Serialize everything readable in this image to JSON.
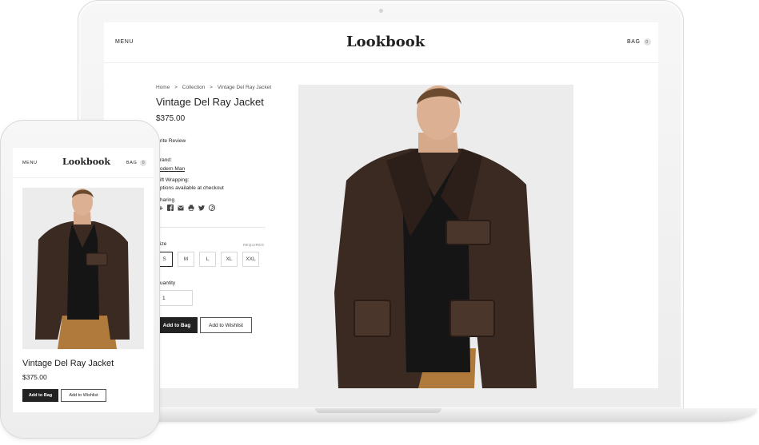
{
  "desktop": {
    "header": {
      "menu_label": "MENU",
      "logo": "Lookbook",
      "bag_label": "BAG",
      "bag_count": "0"
    },
    "breadcrumb": [
      "Home",
      ">",
      "Collection",
      ">",
      "Vintage Del Ray Jacket"
    ],
    "product": {
      "title": "Vintage Del Ray Jacket",
      "price": "$375.00",
      "write_review": "rite Review",
      "brand_label": "rand:",
      "brand_value": "odern Man",
      "gift_label": "ift Wrapping:",
      "gift_value": "ptions available at checkout",
      "sharing_label": "haring",
      "size_label": "ize",
      "required_label": "REQUIRED",
      "sizes": [
        "S",
        "M",
        "L",
        "XL",
        "XXL"
      ],
      "selected_size": "S",
      "quantity_label": "uantity",
      "quantity_value": "1",
      "add_to_bag": "Add to Bag",
      "add_to_wishlist": "Add to Wishlist"
    },
    "social_icons": [
      "plus-icon",
      "facebook-icon",
      "email-icon",
      "print-icon",
      "twitter-icon",
      "pinterest-icon"
    ]
  },
  "mobile": {
    "header": {
      "menu_label": "MENU",
      "logo": "Lookbook",
      "bag_label": "BAG",
      "bag_count": "0"
    },
    "product": {
      "title": "Vintage Del Ray Jacket",
      "price": "$375.00",
      "add_to_bag": "Add to Bag",
      "add_to_wishlist": "Add to Wishlist"
    }
  },
  "colors": {
    "primary_button": "#222222",
    "jacket": "#3a2a22",
    "shirt": "#151515",
    "pants": "#b07a3d",
    "photo_background": "#ececec"
  }
}
